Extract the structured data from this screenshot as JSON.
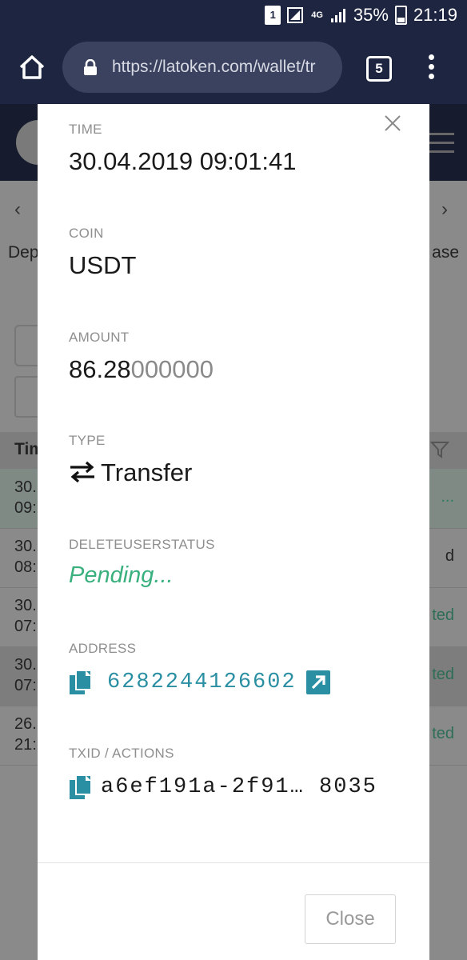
{
  "status_bar": {
    "sim_label": "1",
    "network_label": "4G",
    "battery_percent": "35%",
    "time": "21:19"
  },
  "browser": {
    "url": "https://latoken.com/wallet/tr",
    "tab_count": "5"
  },
  "background_page": {
    "tab_left_label": "Dep",
    "tab_right_label": "ase",
    "table_header": "Tim",
    "rows": [
      {
        "date": "30.",
        "time": "09:",
        "status": "..."
      },
      {
        "date": "30.",
        "time": "08:",
        "status": "d"
      },
      {
        "date": "30.",
        "time": "07:",
        "status": "ted"
      },
      {
        "date": "30.",
        "time": "07:",
        "status": "ted"
      },
      {
        "date": "26.",
        "time": "21:",
        "status": "ted"
      }
    ]
  },
  "modal": {
    "time_label": "TIME",
    "time_value": "30.04.2019 09:01:41",
    "coin_label": "COIN",
    "coin_value": "USDT",
    "amount_label": "AMOUNT",
    "amount_main": "86.28",
    "amount_dim": "000000",
    "type_label": "TYPE",
    "type_value": "Transfer",
    "status_label": "DELETEUSERSTATUS",
    "status_value": "Pending...",
    "address_label": "ADDRESS",
    "address_value": "6282244126602",
    "txid_label": "TXID / ACTIONS",
    "txid_value": "a6ef191a-2f91… 8035",
    "close_button": "Close"
  },
  "colors": {
    "status_bar_bg": "#1d2540",
    "pending_green": "#3ab07e",
    "address_teal": "#2a8fa3"
  }
}
